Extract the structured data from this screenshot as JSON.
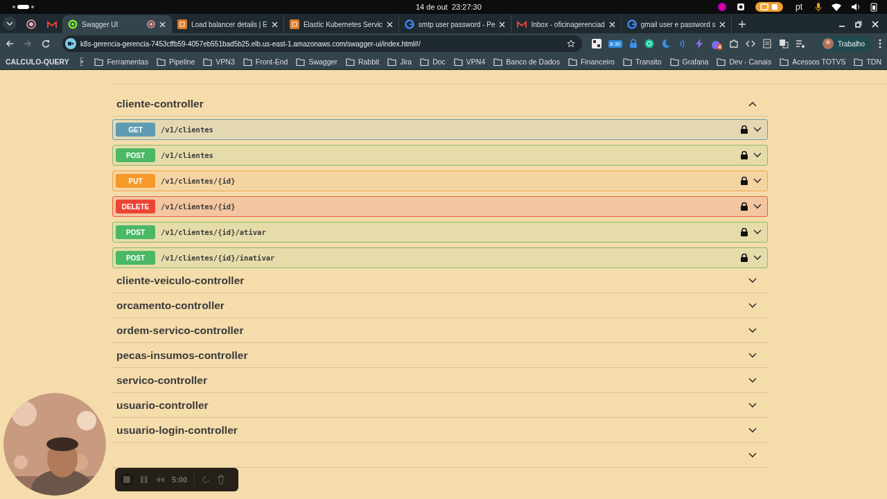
{
  "system_bar": {
    "clock": "14 de out  23:27:30",
    "language": "pt"
  },
  "tabs": [
    {
      "kind": "record",
      "selected": false
    },
    {
      "kind": "gmail",
      "selected": false
    },
    {
      "kind": "swagger",
      "title": "Swagger UI",
      "selected": true
    },
    {
      "kind": "aws",
      "title": "Load balancer details | E",
      "selected": false
    },
    {
      "kind": "aws",
      "title": "Elastic Kubernetes Servic",
      "selected": false
    },
    {
      "kind": "google",
      "title": "smtp user password - Pe",
      "selected": false
    },
    {
      "kind": "gmail",
      "title": "Inbox - oficinagerenciad",
      "selected": false
    },
    {
      "kind": "google",
      "title": "gmail user e password s",
      "selected": false
    }
  ],
  "address_bar": {
    "url": "k8s-gerencia-gerencia-7453cffb59-4057eb551bad5b25.elb.us-east-1.amazonaws.com/swagger-ui/index.html#/"
  },
  "extensions": {
    "timer_badge": "8:30",
    "count_badge": "4"
  },
  "profile": {
    "name": "Trabalho"
  },
  "bookmarks": [
    {
      "kind": "text",
      "label": "CALCULO-QUERY"
    },
    {
      "kind": "apps"
    },
    {
      "kind": "folder",
      "label": "Ferramentas"
    },
    {
      "kind": "folder",
      "label": "Pipeline"
    },
    {
      "kind": "folder",
      "label": "VPN3"
    },
    {
      "kind": "folder",
      "label": "Front-End"
    },
    {
      "kind": "folder",
      "label": "Swagger"
    },
    {
      "kind": "folder",
      "label": "Rabbit"
    },
    {
      "kind": "folder",
      "label": "Jira"
    },
    {
      "kind": "folder",
      "label": "Doc"
    },
    {
      "kind": "folder",
      "label": "VPN4"
    },
    {
      "kind": "folder",
      "label": "Banco de Dados"
    },
    {
      "kind": "folder",
      "label": "Financeiro"
    },
    {
      "kind": "folder",
      "label": "Transito"
    },
    {
      "kind": "folder",
      "label": "Grafana"
    },
    {
      "kind": "folder",
      "label": "Dev - Canais"
    },
    {
      "kind": "folder",
      "label": "Acessos TOTVS"
    },
    {
      "kind": "folder",
      "label": "TDN"
    }
  ],
  "controllers": [
    {
      "name": "cliente-controller",
      "expanded": true,
      "endpoints": [
        {
          "method": "GET",
          "path": "/v1/clientes"
        },
        {
          "method": "POST",
          "path": "/v1/clientes"
        },
        {
          "method": "PUT",
          "path": "/v1/clientes/{id}"
        },
        {
          "method": "DELETE",
          "path": "/v1/clientes/{id}"
        },
        {
          "method": "POST",
          "path": "/v1/clientes/{id}/ativar"
        },
        {
          "method": "POST",
          "path": "/v1/clientes/{id}/inativar"
        }
      ]
    },
    {
      "name": "cliente-veiculo-controller",
      "expanded": false
    },
    {
      "name": "orcamento-controller",
      "expanded": false
    },
    {
      "name": "ordem-servico-controller",
      "expanded": false
    },
    {
      "name": "pecas-insumos-controller",
      "expanded": false
    },
    {
      "name": "servico-controller",
      "expanded": false
    },
    {
      "name": "usuario-controller",
      "expanded": false
    },
    {
      "name": "usuario-login-controller",
      "expanded": false
    },
    {
      "expanded": false
    }
  ],
  "recorder": {
    "time": "5:00"
  }
}
